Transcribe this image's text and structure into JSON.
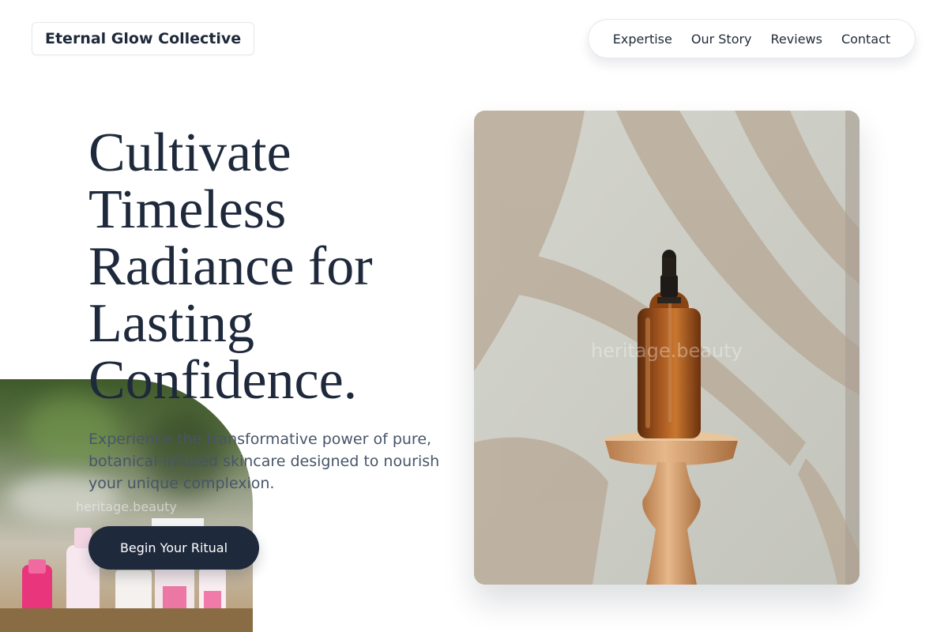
{
  "brand": {
    "name": "Eternal Glow Collective"
  },
  "nav": {
    "items": [
      {
        "label": "Expertise"
      },
      {
        "label": "Our Story"
      },
      {
        "label": "Reviews"
      },
      {
        "label": "Contact"
      }
    ]
  },
  "hero": {
    "headline_lines": [
      "Cultivate",
      "Timeless",
      "Radiance for",
      "Lasting",
      "Confidence."
    ],
    "subtext": "Experience the transformative power of pure, botanical-infused skincare designed to nourish your unique complexion.",
    "cta_label": "Begin Your Ritual"
  },
  "watermarks": {
    "left": "heritage.beauty",
    "right": "heritage.beauty"
  },
  "images": {
    "product_lineup": {
      "icon": "skincare-products-photo"
    },
    "serum_bottle": {
      "icon": "amber-serum-bottle-photo"
    }
  },
  "colors": {
    "primary_dark": "#1e293b",
    "text_muted": "#475569",
    "background": "#ffffff"
  }
}
